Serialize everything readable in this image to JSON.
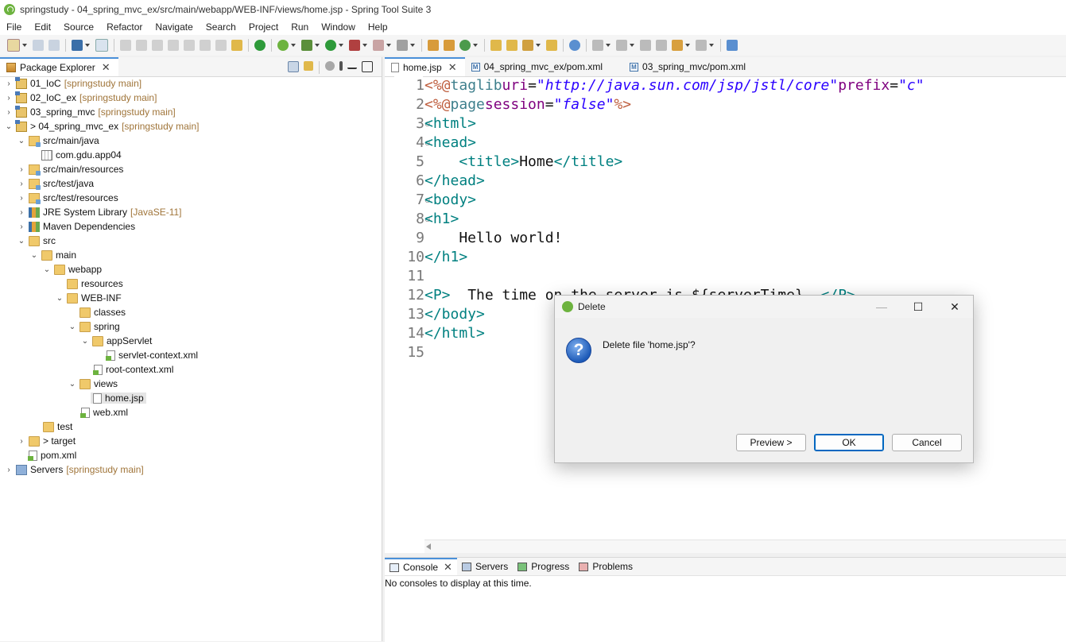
{
  "window": {
    "title": "springstudy - 04_spring_mvc_ex/src/main/webapp/WEB-INF/views/home.jsp - Spring Tool Suite 3"
  },
  "menu": [
    "File",
    "Edit",
    "Source",
    "Refactor",
    "Navigate",
    "Search",
    "Project",
    "Run",
    "Window",
    "Help"
  ],
  "explorer": {
    "tab_label": "Package Explorer",
    "rows": [
      {
        "label": "01_IoC",
        "deco": "[springstudy main]"
      },
      {
        "label": "02_IoC_ex",
        "deco": "[springstudy main]"
      },
      {
        "label": "03_spring_mvc",
        "deco": "[springstudy main]"
      },
      {
        "label": "> 04_spring_mvc_ex",
        "deco": "[springstudy main]"
      },
      {
        "label": "src/main/java"
      },
      {
        "label": "com.gdu.app04"
      },
      {
        "label": "src/main/resources"
      },
      {
        "label": "src/test/java"
      },
      {
        "label": "src/test/resources"
      },
      {
        "label": "JRE System Library",
        "deco": "[JavaSE-11]"
      },
      {
        "label": "Maven Dependencies"
      },
      {
        "label": "src"
      },
      {
        "label": "main"
      },
      {
        "label": "webapp"
      },
      {
        "label": "resources"
      },
      {
        "label": "WEB-INF"
      },
      {
        "label": "classes"
      },
      {
        "label": "spring"
      },
      {
        "label": "appServlet"
      },
      {
        "label": "servlet-context.xml"
      },
      {
        "label": "root-context.xml"
      },
      {
        "label": "views"
      },
      {
        "label": "home.jsp"
      },
      {
        "label": "web.xml"
      },
      {
        "label": "test"
      },
      {
        "label": "> target"
      },
      {
        "label": "pom.xml"
      },
      {
        "label": "Servers",
        "deco": "[springstudy main]"
      }
    ]
  },
  "editor": {
    "tabs": [
      {
        "label": "home.jsp"
      },
      {
        "label": "04_spring_mvc_ex/pom.xml"
      },
      {
        "label": "03_spring_mvc/pom.xml"
      }
    ],
    "line_numbers": [
      "1",
      "2",
      "3",
      "4",
      "5",
      "6",
      "7",
      "8",
      "9",
      "10",
      "11",
      "12",
      "13",
      "14",
      "15"
    ],
    "code": {
      "l1": {
        "open": "<%@",
        "kw": " taglib ",
        "a1": "uri",
        "eq1": "=",
        "v1": "\"http://java.sun.com/jsp/jstl/core\"",
        "a2": " prefix",
        "eq2": "=",
        "v2": "\"c\""
      },
      "l2": {
        "open": "<%@",
        "kw": " page ",
        "a1": "session",
        "eq1": "=",
        "v1": "\"false\"",
        "close": " %>"
      },
      "l3": "<html>",
      "l4": "<head>",
      "l5": {
        "indent": "    ",
        "open": "<title>",
        "text": "Home",
        "close": "</title>"
      },
      "l6": "</head>",
      "l7": "<body>",
      "l8": "<h1>",
      "l9": "    Hello world!",
      "l10": "</h1>",
      "l11": "",
      "l12": {
        "open": "<P>",
        "text": "  The time on the server is ${serverTime}. ",
        "close": "</P>"
      },
      "l13": "</body>",
      "l14": "</html>",
      "l15": ""
    }
  },
  "console": {
    "tabs": [
      "Console",
      "Servers",
      "Progress",
      "Problems"
    ],
    "message": "No consoles to display at this time."
  },
  "dialog": {
    "title": "Delete",
    "message": "Delete file 'home.jsp'?",
    "preview_label": "Preview >",
    "ok_label": "OK",
    "cancel_label": "Cancel",
    "minimize_glyph": "—",
    "maximize_glyph": "☐",
    "close_glyph": "✕",
    "question_glyph": "?"
  },
  "colors": {
    "tag": "#3e7f8c",
    "directive": "#bf5f3f",
    "attribute": "#7f007f",
    "string": "#2a00ff",
    "accent": "#4a90d9",
    "spring_green": "#6db33f"
  }
}
